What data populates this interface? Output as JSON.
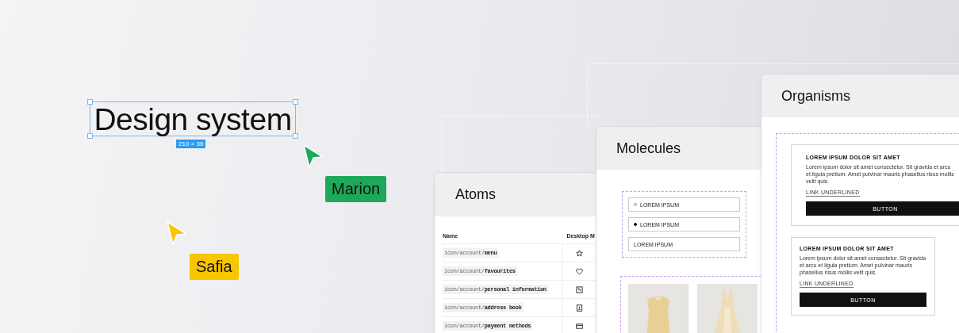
{
  "canvas": {
    "heading": "Design system",
    "dimensions": "210 × 36"
  },
  "cursors": [
    {
      "name": "Marion",
      "color": "#1ea85a"
    },
    {
      "name": "Safia",
      "color": "#f7c600"
    }
  ],
  "atoms": {
    "title": "Atoms",
    "columns": [
      "Name",
      "Desktop",
      "M"
    ],
    "rows": [
      {
        "prefix": "icon/account/",
        "name": "menu"
      },
      {
        "prefix": "icon/account/",
        "name": "favourites"
      },
      {
        "prefix": "icon/account/",
        "name": "personal information"
      },
      {
        "prefix": "icon/account/",
        "name": "address book"
      },
      {
        "prefix": "icon/account/",
        "name": "payment methods"
      }
    ]
  },
  "molecules": {
    "title": "Molecules",
    "options": [
      {
        "kind": "radio",
        "label": "LOREM IPSUM",
        "selected": false
      },
      {
        "kind": "radio",
        "label": "LOREM IPSUM",
        "selected": true
      },
      {
        "kind": "text",
        "label": "LOREM IPSUM"
      }
    ]
  },
  "organisms": {
    "title": "Organisms",
    "cards": [
      {
        "title": "LOREM IPSUM DOLOR SIT AMET",
        "body": "Lorem ipsum dolor sit amet consectetur. Sit gravida et arcu et ligula pretium. Amet pulvinar mauris phasellus risus mollis velit quis.",
        "link": "LINK UNDERLINED",
        "button": "BUTTON"
      },
      {
        "title": "LOREM IPSUM DOLOR SIT AMET",
        "body": "Lorem ipsum dolor sit amet consectetur. Sit gravida et arcu et ligula pretium. Amet pulvinar mauris phasellus risus mollis velit quis.",
        "link": "LINK UNDERLINED",
        "button": "BUTTON"
      }
    ]
  }
}
